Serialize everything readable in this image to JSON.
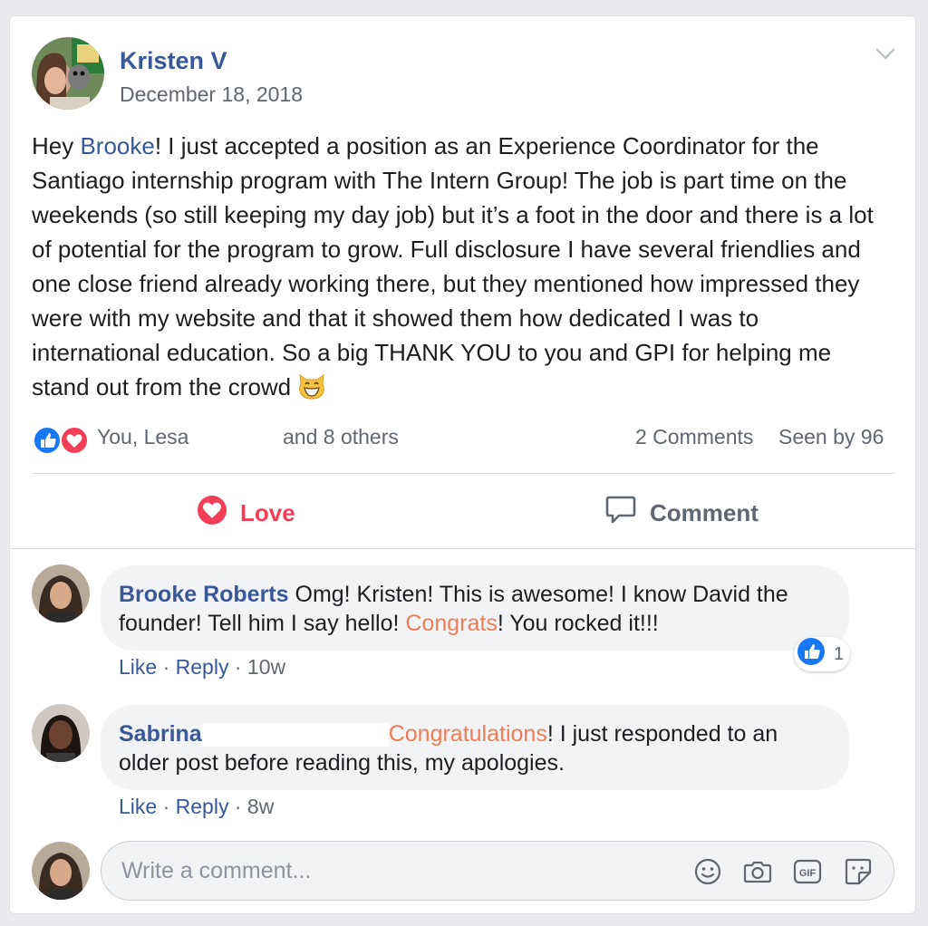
{
  "post": {
    "author": "Kristen V",
    "date": "December 18, 2018",
    "text_part1": "Hey ",
    "mention": "Brooke",
    "text_part2": "! I just accepted a position as an Experience Coordinator for the Santiago internship program with The Intern Group! The job is part time on the weekends (so still keeping my day job) but it’s a foot in the door and there is a lot of potential for the program to grow. Full disclosure I have several friendlies and one close friend already working there, but they mentioned how impressed they were with my website and that it showed them how dedicated I was to international education. So a big THANK YOU to you and GPI for helping me stand out from the crowd ",
    "emoji": "grinning-cat-emoji"
  },
  "reactions": {
    "names": "You, Lesa",
    "others": "and 8 others",
    "comments_count": "2 Comments",
    "seen_by": "Seen by 96",
    "icons": [
      "like-icon",
      "love-icon"
    ],
    "colors": {
      "like": "#1877f2",
      "love": "#f33e58"
    }
  },
  "actions": {
    "love_label": "Love",
    "comment_label": "Comment"
  },
  "comments": [
    {
      "name": "Brooke Roberts",
      "text_part1": " Omg! Kristen! This is awesome! I know David the founder! Tell him I say hello! ",
      "highlight": "Congrats",
      "text_part2": "! You rocked it!!!",
      "like_label": "Like",
      "reply_label": "Reply",
      "time": "10w",
      "like_count": "1"
    },
    {
      "name": "Sabrina",
      "highlight": "Congratulations",
      "text_part2": "! I just responded to an older post before reading this, my apologies.",
      "like_label": "Like",
      "reply_label": "Reply",
      "time": "8w"
    }
  ],
  "composer": {
    "placeholder": "Write a comment...",
    "icons": [
      "emoji-icon",
      "camera-icon",
      "gif-icon",
      "sticker-icon"
    ]
  },
  "colors": {
    "link_blue": "#385898",
    "highlight_orange": "#f07c56",
    "secondary_text": "#606770"
  }
}
